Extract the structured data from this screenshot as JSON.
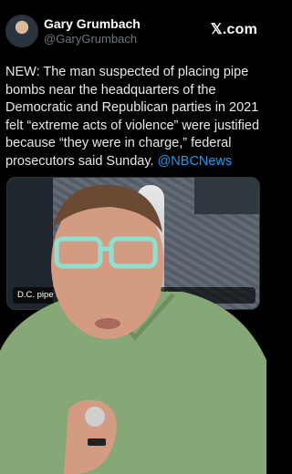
{
  "author": {
    "name": "Gary Grumbach",
    "handle": "@GaryGrumbach"
  },
  "brand": "𝕏.com",
  "post": {
    "text": "NEW: The man suspected of placing pipe bombs near the headquarters of the Democratic and Republican parties in 2021 felt “extreme acts of violence” were justified because “they were in charge,” federal prosecutors said Sunday. ",
    "mention": "@NBCNews"
  },
  "media": {
    "caption": "D.C. pipe bom... political parties and fel..."
  },
  "icons": {
    "share": "share-icon",
    "logo": "x-logo"
  },
  "colors": {
    "background": "#000000",
    "link": "#1d9bf0",
    "shirt": "#86a876",
    "glasses": "#8fe0d0"
  }
}
